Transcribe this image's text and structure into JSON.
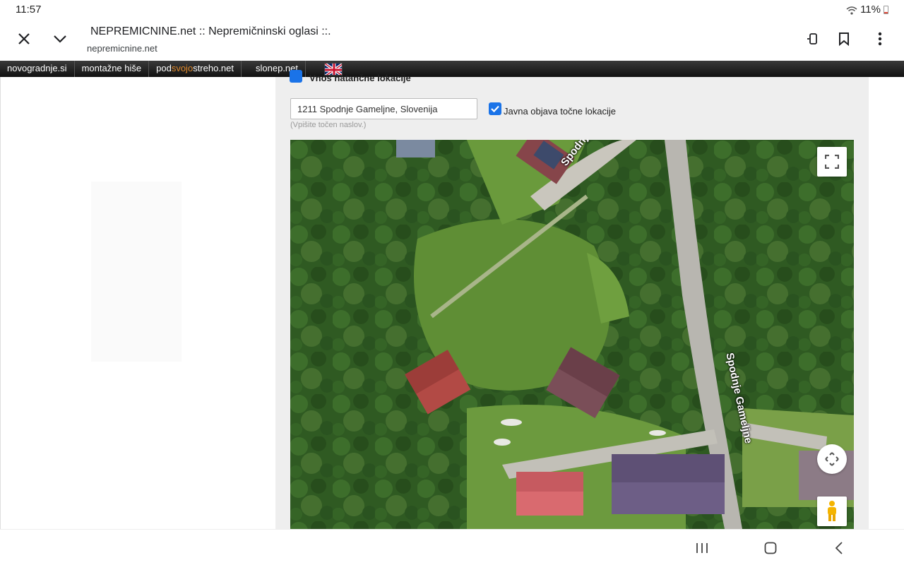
{
  "status": {
    "time": "11:57",
    "battery": "11%"
  },
  "browser": {
    "title": "NEPREMICNINE.net :: Nepremičninski oglasi ::.",
    "url": "nepremicnine.net"
  },
  "sitenav": {
    "items": [
      "novogradnje.si",
      "montažne hiše",
      "slonep.net"
    ],
    "podsvojostreho": {
      "pre": "pod",
      "hl": "svojo",
      "post": "streho.net"
    }
  },
  "location": {
    "section_title": "Vnos natančne lokacije",
    "address_value": "1211 Spodnje Gameljne, Slovenija",
    "address_hint": "(Vpišite točen naslov.)",
    "public_label": "Javna objava točne lokacije",
    "public_checked": true
  },
  "map": {
    "street_label_top": "Spodnje Gameljne",
    "street_label_right": "Spodnje Gameljne"
  },
  "colors": {
    "accent": "#1a73e8",
    "nav_highlight": "#e08a2c"
  }
}
